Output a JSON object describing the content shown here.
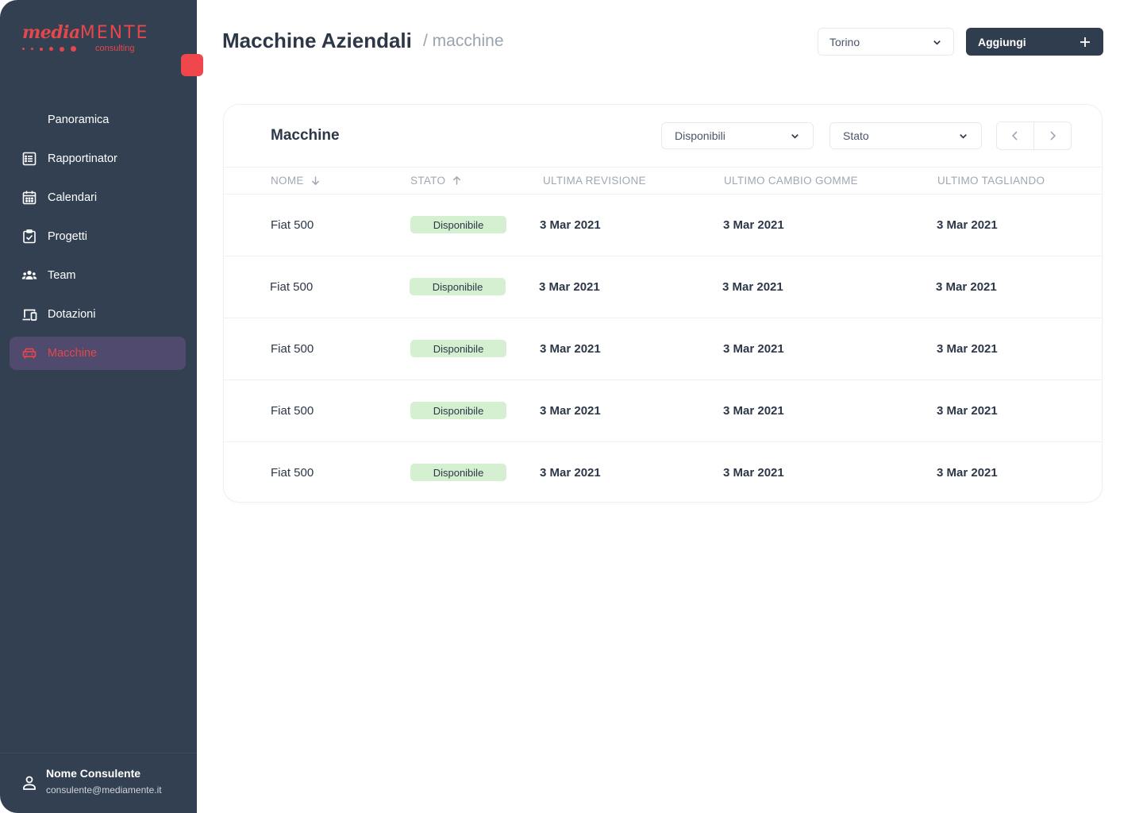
{
  "sidebar": {
    "logo": {
      "script": "media",
      "caps": "MENTE",
      "sub": "consulting"
    },
    "items": [
      {
        "label": "Panoramica",
        "icon": "none"
      },
      {
        "label": "Rapportinator",
        "icon": "list-icon"
      },
      {
        "label": "Calendari",
        "icon": "calendar-icon"
      },
      {
        "label": "Progetti",
        "icon": "checklist-icon"
      },
      {
        "label": "Team",
        "icon": "team-icon"
      },
      {
        "label": "Dotazioni",
        "icon": "devices-icon"
      },
      {
        "label": "Macchine",
        "icon": "car-icon",
        "active": true
      }
    ],
    "user": {
      "name": "Nome Consulente",
      "email": "consulente@mediamente.it"
    }
  },
  "header": {
    "title": "Macchine Aziendali",
    "breadcrumb": "/ macchine",
    "city": "Torino",
    "add_label": "Aggiungi"
  },
  "card": {
    "title": "Macchine",
    "filter_availability": "Disponibili",
    "filter_status": "Stato",
    "columns": [
      "NOME",
      "STATO",
      "ULTIMA REVISIONE",
      "ULTIMO CAMBIO GOMME",
      "ULTIMO TAGLIANDO"
    ],
    "rows": [
      {
        "name": "Fiat 500",
        "status": "Disponibile",
        "revision": "3 Mar 2021",
        "tyres": "3 Mar 2021",
        "service": "3 Mar 2021"
      },
      {
        "name": "Fiat 500",
        "status": "Disponibile",
        "revision": "3 Mar 2021",
        "tyres": "3 Mar 2021",
        "service": "3 Mar 2021"
      },
      {
        "name": "Fiat 500",
        "status": "Disponibile",
        "revision": "3 Mar 2021",
        "tyres": "3 Mar 2021",
        "service": "3 Mar 2021"
      },
      {
        "name": "Fiat 500",
        "status": "Disponibile",
        "revision": "3 Mar 2021",
        "tyres": "3 Mar 2021",
        "service": "3 Mar 2021"
      },
      {
        "name": "Fiat 500",
        "status": "Disponibile",
        "revision": "3 Mar 2021",
        "tyres": "3 Mar 2021",
        "service": "3 Mar 2021"
      }
    ]
  },
  "colors": {
    "sidebar_bg": "#334052",
    "accent": "#e4474c",
    "active_item_bg": "#4f4a6e",
    "badge_bg": "#d4f0d1",
    "primary_button": "#2f3d4f"
  }
}
